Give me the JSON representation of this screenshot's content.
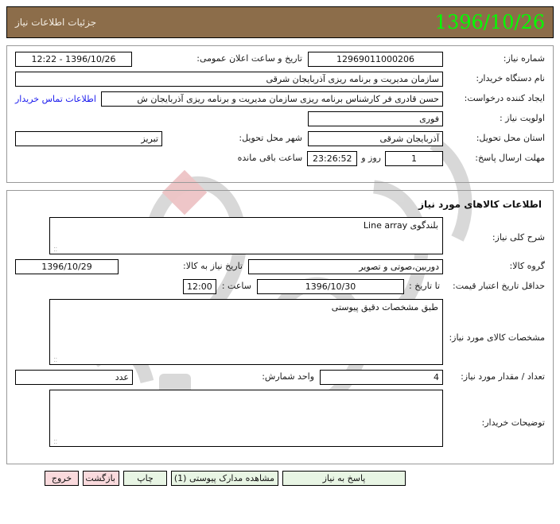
{
  "header": {
    "title": "جزئیات اطلاعات نیاز",
    "date": "1396/10/26",
    "bg_color": "#8c6d4a",
    "date_color": "#00ff00"
  },
  "top_panel": {
    "need_number_label": "شماره نیاز:",
    "need_number_value": "12969011000206",
    "announce_label": "تاریخ و ساعت اعلان عمومی:",
    "announce_value": "1396/10/26 - 12:22",
    "buyer_org_label": "نام دستگاه خریدار:",
    "buyer_org_value": "سازمان مدیریت و برنامه ریزی  آذربایجان شرقی",
    "creator_label": "ایجاد کننده درخواست:",
    "creator_value": "حسن قادری فر کارشناس برنامه ریزی سازمان مدیریت و برنامه ریزی  آذربایجان ش",
    "contact_link": "اطلاعات تماس خریدار",
    "priority_label": "اولویت نیاز :",
    "priority_value": "فوری",
    "province_label": "استان محل تحویل:",
    "province_value": "آذربایجان شرقی",
    "city_label": "شهر محل تحویل:",
    "city_value": "تبریز",
    "deadline_label": "مهلت ارسال پاسخ:",
    "deadline_days": "1",
    "deadline_days_suffix": "روز و",
    "deadline_time": "23:26:52",
    "deadline_time_suffix": "ساعت باقی مانده"
  },
  "goods_panel": {
    "title": "اطلاعات کالاهای مورد نیاز",
    "summary_label": "شرح کلی نیاز:",
    "summary_value": "بلندگوی  Line array",
    "group_label": "گروه کالا:",
    "group_value": "دوربین،صوتی و تصویر",
    "need_date_label": "تاریخ نیاز به کالا:",
    "need_date_value": "1396/10/29",
    "price_validity_label": "حداقل تاریخ اعتبار قیمت:",
    "price_validity_until_label": "تا تاریخ :",
    "price_validity_date": "1396/10/30",
    "price_validity_hour_label": "ساعت :",
    "price_validity_hour": "12:00",
    "specs_label": "مشخصات کالای مورد نیاز:",
    "specs_value": "طبق مشخصات دقیق پیوستی",
    "quantity_label": "تعداد / مقدار مورد نیاز:",
    "quantity_value": "4",
    "unit_label": "واحد شمارش:",
    "unit_value": "عدد",
    "buyer_notes_label": "توضیحات خریدار:",
    "buyer_notes_value": ""
  },
  "footer": {
    "respond_label": "پاسخ به نیاز",
    "attachments_label": "مشاهده مدارک پیوستی (1)",
    "print_label": "چاپ",
    "back_label": "بازگشت",
    "exit_label": "خروج",
    "green_color": "#e8f5e4",
    "pink_color": "#fadadd"
  }
}
